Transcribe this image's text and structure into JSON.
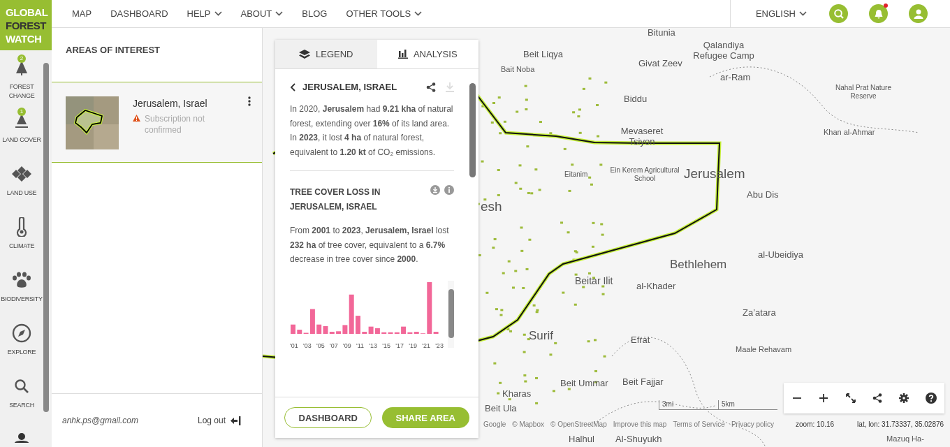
{
  "logo": {
    "lines": [
      "GLOBAL",
      "FOREST",
      "WATCH"
    ]
  },
  "nav": [
    {
      "label": "MAP",
      "dropdown": false
    },
    {
      "label": "DASHBOARD",
      "dropdown": false
    },
    {
      "label": "HELP",
      "dropdown": true
    },
    {
      "label": "ABOUT",
      "dropdown": true
    },
    {
      "label": "BLOG",
      "dropdown": false
    },
    {
      "label": "OTHER TOOLS",
      "dropdown": true
    }
  ],
  "header": {
    "language": "ENGLISH",
    "notification_unread": true
  },
  "sidebar": {
    "items": [
      {
        "label": "FOREST CHANGE",
        "badge": "2"
      },
      {
        "label": "LAND COVER",
        "badge": "1"
      },
      {
        "label": "LAND USE"
      },
      {
        "label": "CLIMATE"
      },
      {
        "label": "BIODIVERSITY"
      },
      {
        "label": "EXPLORE"
      },
      {
        "label": "SEARCH"
      }
    ]
  },
  "areas_panel": {
    "title": "AREAS OF INTEREST",
    "areas": [
      {
        "name": "Jerusalem, Israel",
        "status": "Subscription not confirmed"
      }
    ],
    "email": "anhk.ps@gmail.com",
    "logout": "Log out"
  },
  "analysis_panel": {
    "tabs": [
      {
        "label": "LEGEND",
        "selected": false
      },
      {
        "label": "ANALYSIS",
        "selected": true
      }
    ],
    "area_title": "JERUSALEM, ISRAEL",
    "summary": "In 2020, **Jerusalem** had **9.21 kha** of natural forest, extending over **16%** of its land area. In **2023**, it lost **4 ha** of natural forest, equivalent to **1.20 kt** of CO₂ emissions.",
    "widget": {
      "title": "TREE COVER LOSS IN JERUSALEM, ISRAEL",
      "sentence": "From **2001** to **2023**, **Jerusalem, Israel** lost **232 ha** of tree cover, equivalent to a **6.7%** decrease in tree cover since **2000**.",
      "tick_labels": [
        "'01",
        "'03",
        "'05",
        "'07",
        "'09",
        "'11",
        "'13",
        "'15",
        "'17",
        "'19",
        "'21",
        "'23"
      ]
    },
    "buttons": [
      {
        "label": "DASHBOARD",
        "kind": "outline"
      },
      {
        "label": "SHARE AREA",
        "kind": "filled"
      }
    ]
  },
  "map": {
    "labels": [
      "Bitunia",
      "Beit Liqya",
      "Bait Noba",
      "Givat Zeev",
      "Qalandiya Refugee Camp",
      "ar-Ram",
      "Nahal Prat Nature Reserve",
      "Biddu",
      "Mevaseret Tsiyon",
      "Khan al-Ahmar",
      "esh",
      "Eitanim",
      "Ein Kerem Agricultural School",
      "Jerusalem",
      "Abu Dis",
      "Bethlehem",
      "al-Ubeidiya",
      "Beitar Ilit",
      "al-Khader",
      "Za’atara",
      "Surif",
      "Efrat",
      "Maale Rehavam",
      "Beit Ummar",
      "Beit Fajjar",
      "Kharas",
      "Beit Ula",
      "Halhul",
      "Al-Shuyukh",
      "Mazuq Ha-"
    ],
    "scale": [
      "3mi",
      "5km"
    ],
    "attribution": [
      "Google",
      "© Mapbox",
      "© OpenStreetMap",
      "Improve this map",
      "Terms of Service",
      "Privacy policy"
    ],
    "zoom": "zoom: 10.16",
    "coords": "lat, lon: 31.73337, 35.02876"
  }
}
